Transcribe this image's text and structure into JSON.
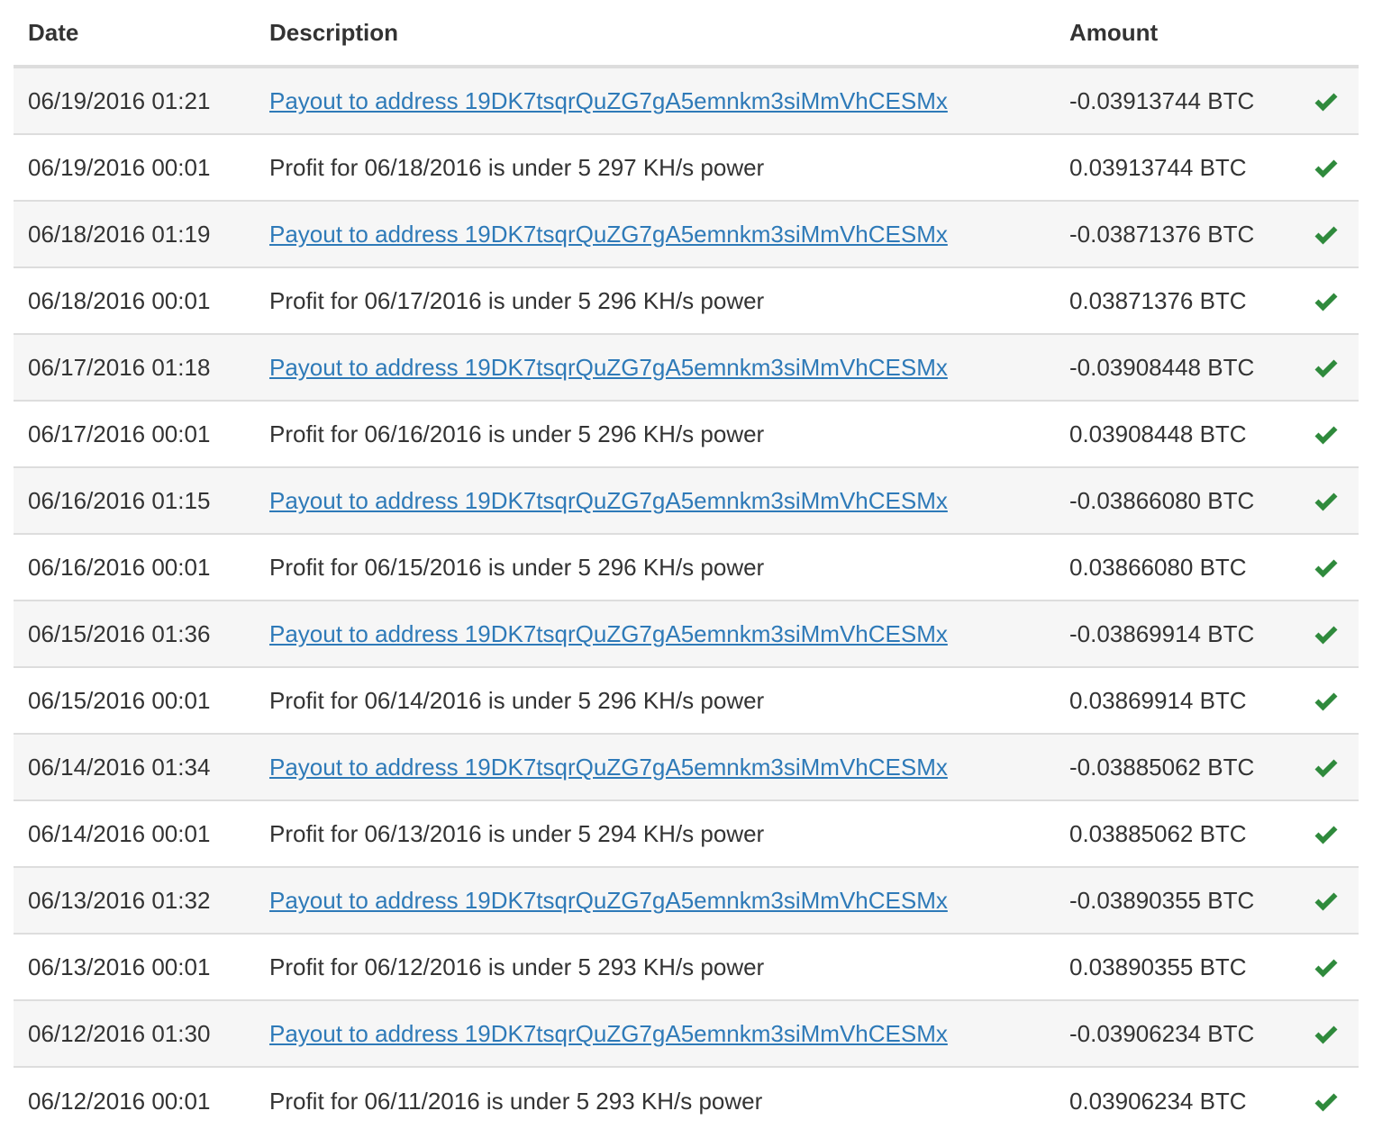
{
  "table": {
    "headers": {
      "date": "Date",
      "description": "Description",
      "amount": "Amount"
    },
    "status_icon": "check-icon",
    "status_color": "#2f8a3c",
    "link_color": "#2e7ab8",
    "rows": [
      {
        "date": "06/19/2016 01:21",
        "description": "Payout to address 19DK7tsqrQuZG7gA5emnkm3siMmVhCESMx",
        "is_link": true,
        "amount": "-0.03913744 BTC"
      },
      {
        "date": "06/19/2016 00:01",
        "description": "Profit for 06/18/2016 is under 5 297 KH/s power",
        "is_link": false,
        "amount": "0.03913744 BTC"
      },
      {
        "date": "06/18/2016 01:19",
        "description": "Payout to address 19DK7tsqrQuZG7gA5emnkm3siMmVhCESMx",
        "is_link": true,
        "amount": "-0.03871376 BTC"
      },
      {
        "date": "06/18/2016 00:01",
        "description": "Profit for 06/17/2016 is under 5 296 KH/s power",
        "is_link": false,
        "amount": "0.03871376 BTC"
      },
      {
        "date": "06/17/2016 01:18",
        "description": "Payout to address 19DK7tsqrQuZG7gA5emnkm3siMmVhCESMx",
        "is_link": true,
        "amount": "-0.03908448 BTC"
      },
      {
        "date": "06/17/2016 00:01",
        "description": "Profit for 06/16/2016 is under 5 296 KH/s power",
        "is_link": false,
        "amount": "0.03908448 BTC"
      },
      {
        "date": "06/16/2016 01:15",
        "description": "Payout to address 19DK7tsqrQuZG7gA5emnkm3siMmVhCESMx",
        "is_link": true,
        "amount": "-0.03866080 BTC"
      },
      {
        "date": "06/16/2016 00:01",
        "description": "Profit for 06/15/2016 is under 5 296 KH/s power",
        "is_link": false,
        "amount": "0.03866080 BTC"
      },
      {
        "date": "06/15/2016 01:36",
        "description": "Payout to address 19DK7tsqrQuZG7gA5emnkm3siMmVhCESMx",
        "is_link": true,
        "amount": "-0.03869914 BTC"
      },
      {
        "date": "06/15/2016 00:01",
        "description": "Profit for 06/14/2016 is under 5 296 KH/s power",
        "is_link": false,
        "amount": "0.03869914 BTC"
      },
      {
        "date": "06/14/2016 01:34",
        "description": "Payout to address 19DK7tsqrQuZG7gA5emnkm3siMmVhCESMx",
        "is_link": true,
        "amount": "-0.03885062 BTC"
      },
      {
        "date": "06/14/2016 00:01",
        "description": "Profit for 06/13/2016 is under 5 294 KH/s power",
        "is_link": false,
        "amount": "0.03885062 BTC"
      },
      {
        "date": "06/13/2016 01:32",
        "description": "Payout to address 19DK7tsqrQuZG7gA5emnkm3siMmVhCESMx",
        "is_link": true,
        "amount": "-0.03890355 BTC"
      },
      {
        "date": "06/13/2016 00:01",
        "description": "Profit for 06/12/2016 is under 5 293 KH/s power",
        "is_link": false,
        "amount": "0.03890355 BTC"
      },
      {
        "date": "06/12/2016 01:30",
        "description": "Payout to address 19DK7tsqrQuZG7gA5emnkm3siMmVhCESMx",
        "is_link": true,
        "amount": "-0.03906234 BTC"
      },
      {
        "date": "06/12/2016 00:01",
        "description": "Profit for 06/11/2016 is under 5 293 KH/s power",
        "is_link": false,
        "amount": "0.03906234 BTC"
      }
    ]
  }
}
